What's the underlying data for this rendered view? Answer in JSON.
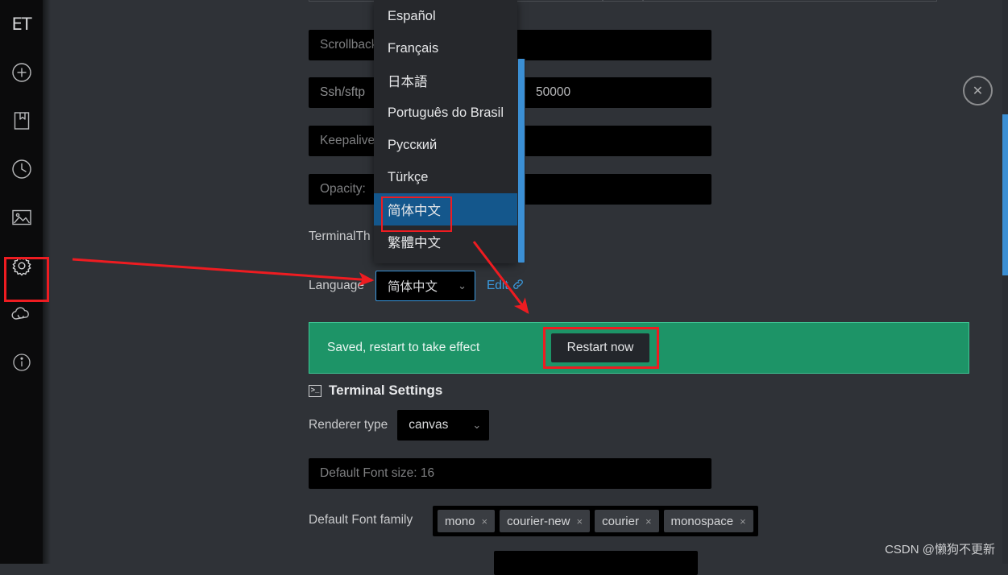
{
  "app": {
    "logo": "ET",
    "watermark": "CSDN @懒狗不更新"
  },
  "sidebar": {
    "items": [
      {
        "name": "logo",
        "label": "ET",
        "icon": "app-logo"
      },
      {
        "name": "new",
        "label": "",
        "icon": "plus-circle-icon"
      },
      {
        "name": "bookmarks",
        "label": "",
        "icon": "bookmark-icon"
      },
      {
        "name": "history",
        "label": "",
        "icon": "clock-icon"
      },
      {
        "name": "gallery",
        "label": "",
        "icon": "image-icon"
      },
      {
        "name": "settings",
        "label": "",
        "icon": "gear-icon"
      },
      {
        "name": "sync",
        "label": "",
        "icon": "cloud-sync-icon"
      },
      {
        "name": "about",
        "label": "",
        "icon": "info-icon"
      }
    ]
  },
  "settings": {
    "rows": {
      "scrollback": {
        "label": "Scrollback",
        "value": ""
      },
      "ssh_sftp": {
        "label": "Ssh/sftp",
        "value": "50000"
      },
      "keepalive": {
        "label": "Keepalive",
        "value": ""
      },
      "opacity": {
        "label": "Opacity:",
        "value": ""
      },
      "terminal_theme": {
        "label": "TerminalTh",
        "value": ""
      },
      "language": {
        "label": "Language",
        "value": "简体中文",
        "caret": "⌄",
        "edit_label": "Edit",
        "edit_icon": "link-icon"
      }
    },
    "banner": {
      "text": "Saved, restart to take effect",
      "button_label": "Restart now",
      "color": "#1d9467"
    },
    "terminal_section": {
      "title": "Terminal Settings",
      "icon": "console-icon",
      "renderer": {
        "label": "Renderer type",
        "value": "canvas",
        "caret": "⌄"
      },
      "font_size": {
        "placeholder": "Default Font size: 16"
      },
      "font_family": {
        "label": "Default Font family",
        "tags": [
          "mono",
          "courier-new",
          "courier",
          "monospace"
        ],
        "remove_icon": "×"
      }
    }
  },
  "dropdown": {
    "name": "language-dropdown",
    "items": [
      {
        "label": "Español",
        "selected": false
      },
      {
        "label": "Français",
        "selected": false
      },
      {
        "label": "日本語",
        "selected": false
      },
      {
        "label": "Português do Brasil",
        "selected": false
      },
      {
        "label": "Русский",
        "selected": false
      },
      {
        "label": "Türkçe",
        "selected": false
      },
      {
        "label": "简体中文",
        "selected": true
      },
      {
        "label": "繁體中文",
        "selected": false
      }
    ],
    "highlight_color": "#14578c",
    "scrollbar_color": "#3b8fd4"
  },
  "close_button": {
    "label": "✕",
    "icon": "close-circle-icon"
  },
  "annotations": {
    "box_color": "#ee1c21",
    "arrow_color": "#ee1c21"
  }
}
